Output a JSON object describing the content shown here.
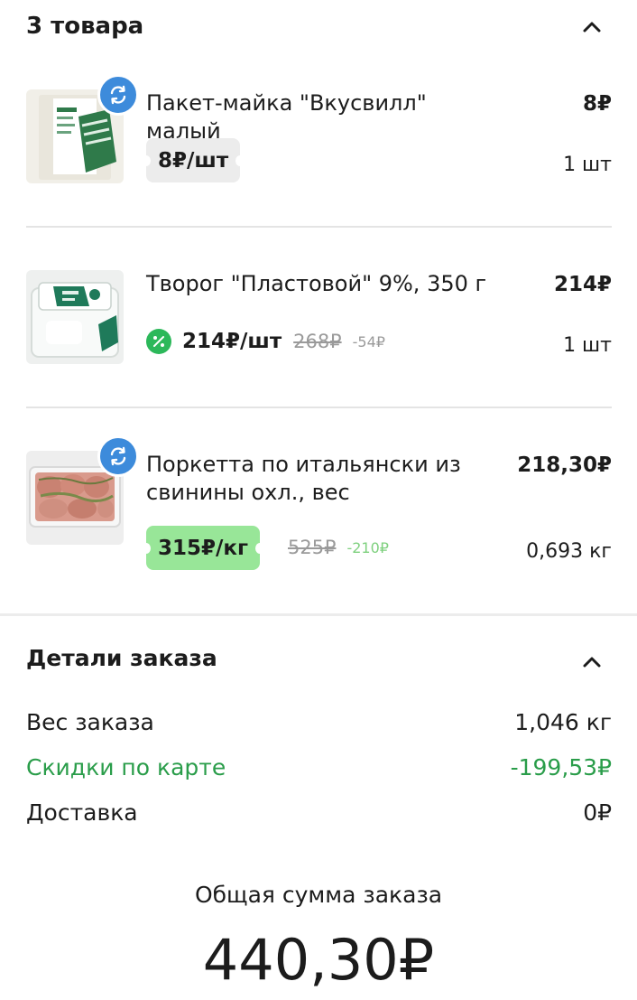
{
  "cart": {
    "header_title": "3 товара",
    "items": [
      {
        "name": "Пакет-майка \"Вкусвилл\" малый",
        "total": "8₽",
        "unit_price": "8₽/шт",
        "quantity": "1 шт",
        "thumb_icon": "bag-product-image",
        "badge_icon": "swap-icon"
      },
      {
        "name": "Творог \"Пластовой\" 9%, 350 г",
        "total": "214₽",
        "unit_price": "214₽/шт",
        "old_price": "268₽",
        "discount": "-54₽",
        "quantity": "1 шт",
        "thumb_icon": "cottage-cheese-product-image",
        "price_icon": "percent-icon"
      },
      {
        "name_line1": "Поркетта по итальянски из",
        "name_line2": "свинины охл., вес",
        "total": "218,30₽",
        "unit_price": "315₽/кг",
        "old_price": "525₽",
        "discount": "-210₽",
        "quantity": "0,693 кг",
        "thumb_icon": "porchetta-product-image",
        "badge_icon": "swap-icon"
      }
    ]
  },
  "order_details": {
    "title": "Детали заказа",
    "weight_label": "Вес заказа",
    "weight_value": "1,046 кг",
    "discount_label": "Скидки по карте",
    "discount_value": "-199,53₽",
    "delivery_label": "Доставка",
    "delivery_value": "0₽"
  },
  "summary": {
    "total_label": "Общая сумма заказа",
    "total_value": "440,30₽"
  },
  "colors": {
    "accent_green": "#2a9d4a",
    "swap_blue": "#3d8bdb",
    "promo_green": "#98e698",
    "percent_green": "#2cb85a"
  }
}
